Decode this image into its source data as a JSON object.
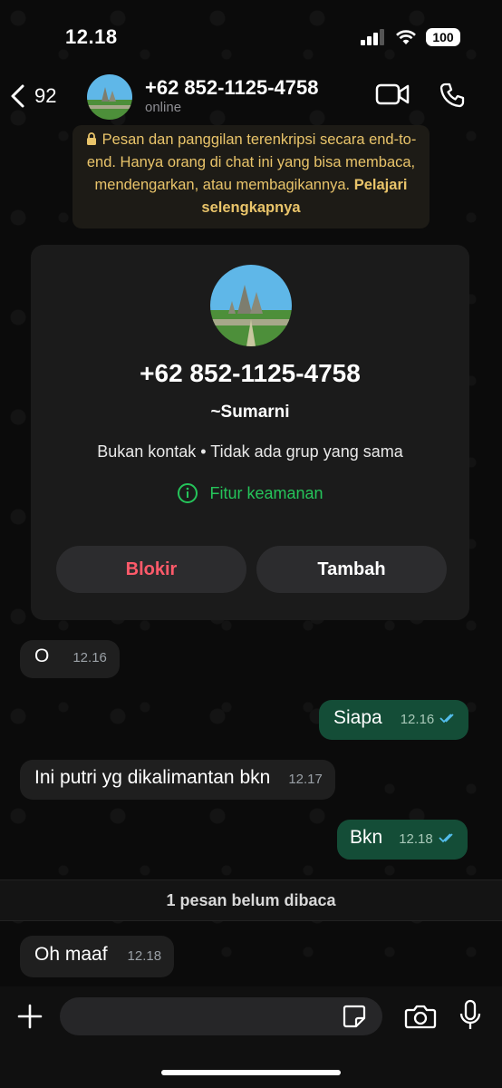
{
  "status_bar": {
    "time": "12.18",
    "battery": "100"
  },
  "header": {
    "back_count": "92",
    "title": "+62 852-1125-4758",
    "subtitle": "online"
  },
  "notice": {
    "text": "Pesan dan panggilan terenkripsi secara end-to-end. Hanya orang di chat ini yang bisa membaca, mendengarkan, atau membagikannya.",
    "link": "Pelajari selengkapnya"
  },
  "contact_card": {
    "phone": "+62 852-1125-4758",
    "name": "~Sumarni",
    "info": "Bukan kontak • Tidak ada grup yang sama",
    "security": "Fitur keamanan",
    "block_label": "Blokir",
    "add_label": "Tambah"
  },
  "messages": [
    {
      "direction": "in",
      "text": "O",
      "time": "12.16"
    },
    {
      "direction": "out",
      "text": "Siapa",
      "time": "12.16"
    },
    {
      "direction": "in",
      "text": "Ini putri yg dikalimantan bkn",
      "time": "12.17"
    },
    {
      "direction": "out",
      "text": "Bkn",
      "time": "12.18"
    },
    {
      "direction": "in",
      "text": "Oh maaf",
      "time": "12.18"
    }
  ],
  "unread_divider": "1 pesan belum dibaca",
  "composer": {
    "placeholder": ""
  },
  "colors": {
    "accent_green": "#25c45a",
    "out_bubble": "#144d37",
    "block_red": "#ff5a6a",
    "notice_text": "#e9c46a",
    "read_ticks": "#53bdeb"
  }
}
